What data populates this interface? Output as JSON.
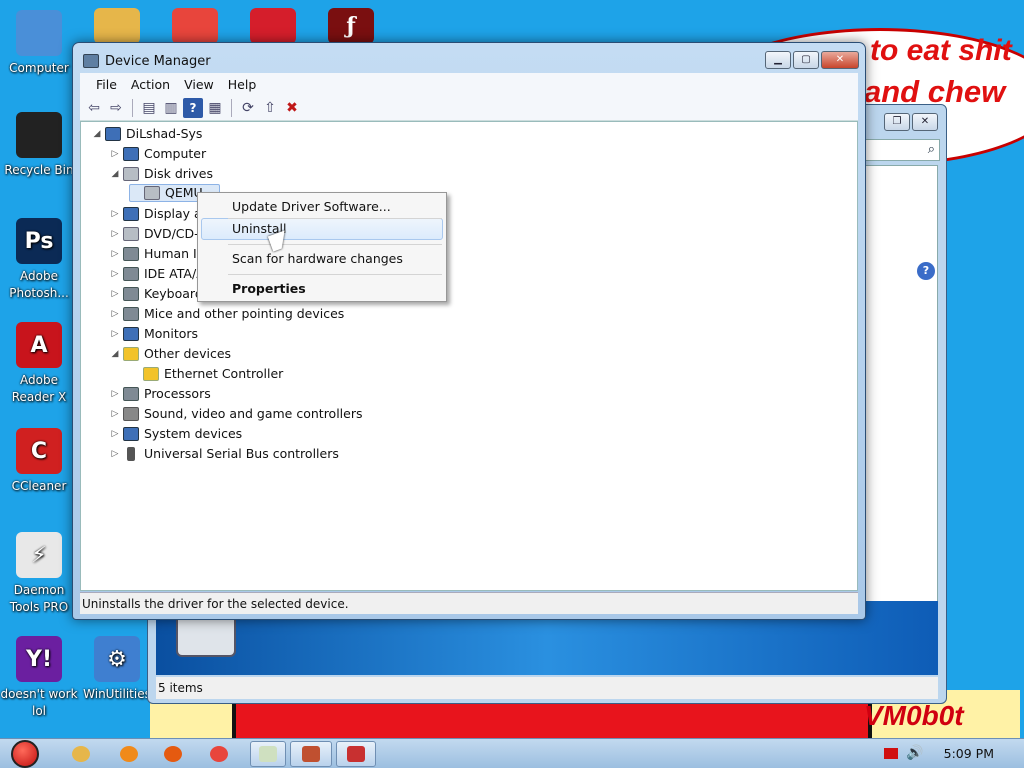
{
  "colors": {
    "desktop": "#1ea3e8",
    "accent_red": "#e01010",
    "title_bar": "#b9d3ee",
    "selection": "#dbe8f7"
  },
  "wallpaper": {
    "text0": "...",
    "text1": "to eat shit",
    "text2": "and chew",
    "signature": "VM0b0t"
  },
  "desktop_icons": [
    {
      "label": "Computer",
      "icon": "computer-icon",
      "color": "#4a8fd8"
    },
    {
      "label": "Recycle Bin",
      "icon": "recycle-bin-icon",
      "color": "#222"
    },
    {
      "label": "Adobe Photosh...",
      "icon": "photoshop-icon",
      "color": "#0b2a55",
      "glyph": "Ps"
    },
    {
      "label": "Adobe Reader X",
      "icon": "adobe-reader-icon",
      "color": "#c8141c",
      "glyph": "A"
    },
    {
      "label": "CCleaner",
      "icon": "ccleaner-icon",
      "color": "#d02020",
      "glyph": "C"
    },
    {
      "label": "Daemon Tools PRO",
      "icon": "daemon-tools-icon",
      "color": "#e8e8e8",
      "glyph": "⚡"
    },
    {
      "label": "doesn't work lol",
      "icon": "yahoo-messenger-icon",
      "color": "#6b1fa0",
      "glyph": "Y!"
    },
    {
      "label": "WinUtilities",
      "icon": "winutilities-icon",
      "color": "#3f7fd0",
      "glyph": "⚙"
    }
  ],
  "top_icons": [
    {
      "icon": "folder-icon",
      "color": "#e6b64a"
    },
    {
      "icon": "chrome-icon",
      "color": "#e8453c"
    },
    {
      "icon": "angry-birds-icon",
      "color": "#d51e2b"
    },
    {
      "icon": "flash-player-icon",
      "color": "#7a0f10",
      "glyph": "ƒ"
    }
  ],
  "device_manager": {
    "title": "Device Manager",
    "menu": [
      "File",
      "Action",
      "View",
      "Help"
    ],
    "toolbar": [
      "back-icon",
      "forward-icon",
      "properties-sheet-icon",
      "console-icon",
      "help-icon",
      "view-icon",
      "scan-hardware-icon",
      "update-driver-icon",
      "uninstall-icon"
    ],
    "tree": {
      "root": "DiLshad-Sys",
      "items": [
        {
          "label": "Computer",
          "icon": "pc",
          "indent": 1,
          "exp": "▷"
        },
        {
          "label": "Disk drives",
          "icon": "disk",
          "indent": 1,
          "exp": "◢"
        },
        {
          "label": "QEMU",
          "icon": "disk",
          "indent": 2,
          "exp": "",
          "selected": true
        },
        {
          "label": "Display a",
          "icon": "pc",
          "indent": 1,
          "exp": "▷"
        },
        {
          "label": "DVD/CD-",
          "icon": "disk",
          "indent": 1,
          "exp": "▷"
        },
        {
          "label": "Human In",
          "icon": "hw",
          "indent": 1,
          "exp": "▷"
        },
        {
          "label": "IDE ATA/A",
          "icon": "hw",
          "indent": 1,
          "exp": "▷"
        },
        {
          "label": "Keyboard",
          "icon": "hw",
          "indent": 1,
          "exp": "▷"
        },
        {
          "label": "Mice and other pointing devices",
          "icon": "hw",
          "indent": 1,
          "exp": "▷"
        },
        {
          "label": "Monitors",
          "icon": "pc",
          "indent": 1,
          "exp": "▷"
        },
        {
          "label": "Other devices",
          "icon": "warn",
          "indent": 1,
          "exp": "◢"
        },
        {
          "label": "Ethernet Controller",
          "icon": "warn",
          "indent": 2,
          "exp": ""
        },
        {
          "label": "Processors",
          "icon": "hw",
          "indent": 1,
          "exp": "▷"
        },
        {
          "label": "Sound, video and game controllers",
          "icon": "snd",
          "indent": 1,
          "exp": "▷"
        },
        {
          "label": "System devices",
          "icon": "pc",
          "indent": 1,
          "exp": "▷"
        },
        {
          "label": "Universal Serial Bus controllers",
          "icon": "usb",
          "indent": 1,
          "exp": "▷"
        }
      ]
    },
    "status": "Uninstalls the driver for the selected device.",
    "context_menu": [
      "Update Driver Software...",
      "Uninstall",
      "Scan for hardware changes",
      "Properties"
    ]
  },
  "back_window": {
    "status": "5 items"
  },
  "taskbar": {
    "apps": [
      {
        "icon": "explorer-icon",
        "color": "#e6b64a"
      },
      {
        "icon": "media-player-icon",
        "color": "#f08a1a"
      },
      {
        "icon": "firefox-icon",
        "color": "#e55a10"
      },
      {
        "icon": "chrome-icon",
        "color": "#e8453c"
      },
      {
        "icon": "notepad-icon",
        "color": "#cfe0c0"
      },
      {
        "icon": "program-icon",
        "color": "#c05030"
      },
      {
        "icon": "device-manager-icon",
        "color": "#c83030"
      }
    ],
    "time": "5:09 PM"
  }
}
